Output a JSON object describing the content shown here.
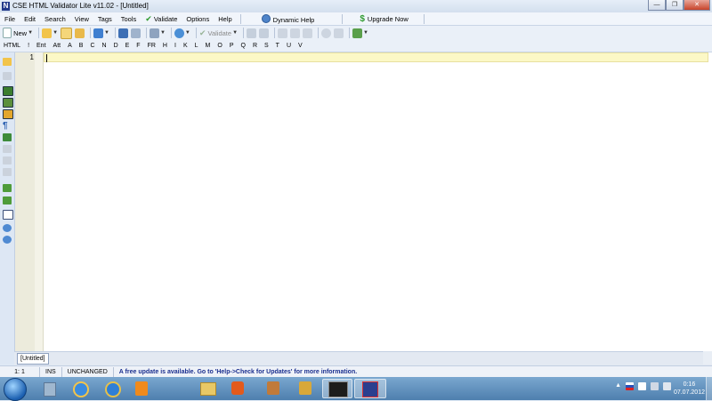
{
  "window": {
    "title": "CSE HTML Validator Lite v11.02 - [Untitled]",
    "app_icon_letter": "N"
  },
  "menu": {
    "items": [
      "File",
      "Edit",
      "Search",
      "View",
      "Tags",
      "Tools"
    ],
    "validate_label": "Validate",
    "options_label": "Options",
    "help_label": "Help",
    "dynamic_help_label": "Dynamic Help",
    "upgrade_label": "Upgrade Now"
  },
  "toolbar": {
    "new_label": "New",
    "validate_label": "Validate"
  },
  "tagbar": [
    "HTML",
    "!",
    "Ent",
    "Att",
    "A",
    "B",
    "C",
    "N",
    "D",
    "E",
    "F",
    "FR",
    "H",
    "I",
    "K",
    "L",
    "M",
    "O",
    "P",
    "Q",
    "R",
    "S",
    "T",
    "U",
    "V"
  ],
  "editor": {
    "line_numbers": [
      "1"
    ]
  },
  "doc_tab": "[Untitled]",
  "status": {
    "position": "1: 1",
    "mode": "INS",
    "state": "UNCHANGED",
    "message": "A free update is available. Go to 'Help->Check for Updates' for more information."
  },
  "taskbar": {
    "time": "0:16",
    "date": "07.07.2012",
    "icons": [
      "explorer-icon",
      "ie-icon",
      "ie-icon-2",
      "odnoklassniki-icon",
      "folder-icon",
      "media-player-icon",
      "network-icon",
      "tools-icon",
      "game-icon",
      "html-validator-icon"
    ]
  },
  "colors": {
    "current_line": "#fcf8c6",
    "status_message": "#1b2f8f",
    "upgrade": "#2f9b2f"
  }
}
